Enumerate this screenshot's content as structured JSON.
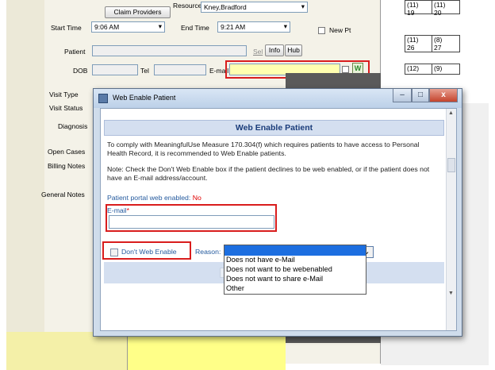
{
  "background_form": {
    "claim_providers_label": "Claim Providers",
    "resource_label": "Resource",
    "resource_value": "Kney,Bradford",
    "start_time_label": "Start Time",
    "start_time_value": "9:06 AM",
    "end_time_label": "End Time",
    "end_time_value": "9:21 AM",
    "new_pt_label": "New Pt",
    "patient_label": "Patient",
    "sel_label": "Sel",
    "info_label": "Info",
    "hub_label": "Hub",
    "dob_label": "DOB",
    "tel_label": "Tel",
    "email_label": "E-mail",
    "w_label": "W",
    "side_labels": [
      "Visit Type",
      "Visit Status",
      "Diagnosis",
      "Open Cases",
      "Billing Notes",
      "General Notes"
    ]
  },
  "calendar": {
    "cells": [
      "(11)",
      "(11)",
      "19",
      "20",
      "(11)",
      "(8)",
      "26",
      "27",
      "(12)",
      "(9)"
    ]
  },
  "dialog": {
    "title": "Web Enable Patient",
    "window_controls": [
      "–",
      "□",
      "x"
    ],
    "section_header": "Web Enable Patient",
    "paragraph1": "To comply with MeaningfulUse Measure 170.304(f) which requires patients to have access to Personal Health Record, it is recommended to Web Enable patients.",
    "paragraph2": "Note: Check the Don't Web Enable box if the patient declines to be web enabled, or if the patient does not have an E-mail address/account.",
    "portal_status_label": "Patient portal web enabled:",
    "portal_status_value": "No",
    "email_label": "E-mail",
    "email_required_marker": "*",
    "email_value": "",
    "dont_web_enable_label": "Don't Web Enable",
    "dont_web_enable_checked": false,
    "reason_label": "Reason:",
    "reason_selected": ""
  },
  "reason_dropdown": {
    "options": [
      "",
      "Does not have e-Mail",
      "Does not want to be webenabled",
      "Does not want to share e-Mail",
      "Other"
    ]
  },
  "colors": {
    "accent_blue": "#1464d8",
    "label_blue": "#245a9e",
    "required_red": "#e00000",
    "highlight_red": "#d91d1d",
    "email_yellow": "#ffffb0"
  }
}
